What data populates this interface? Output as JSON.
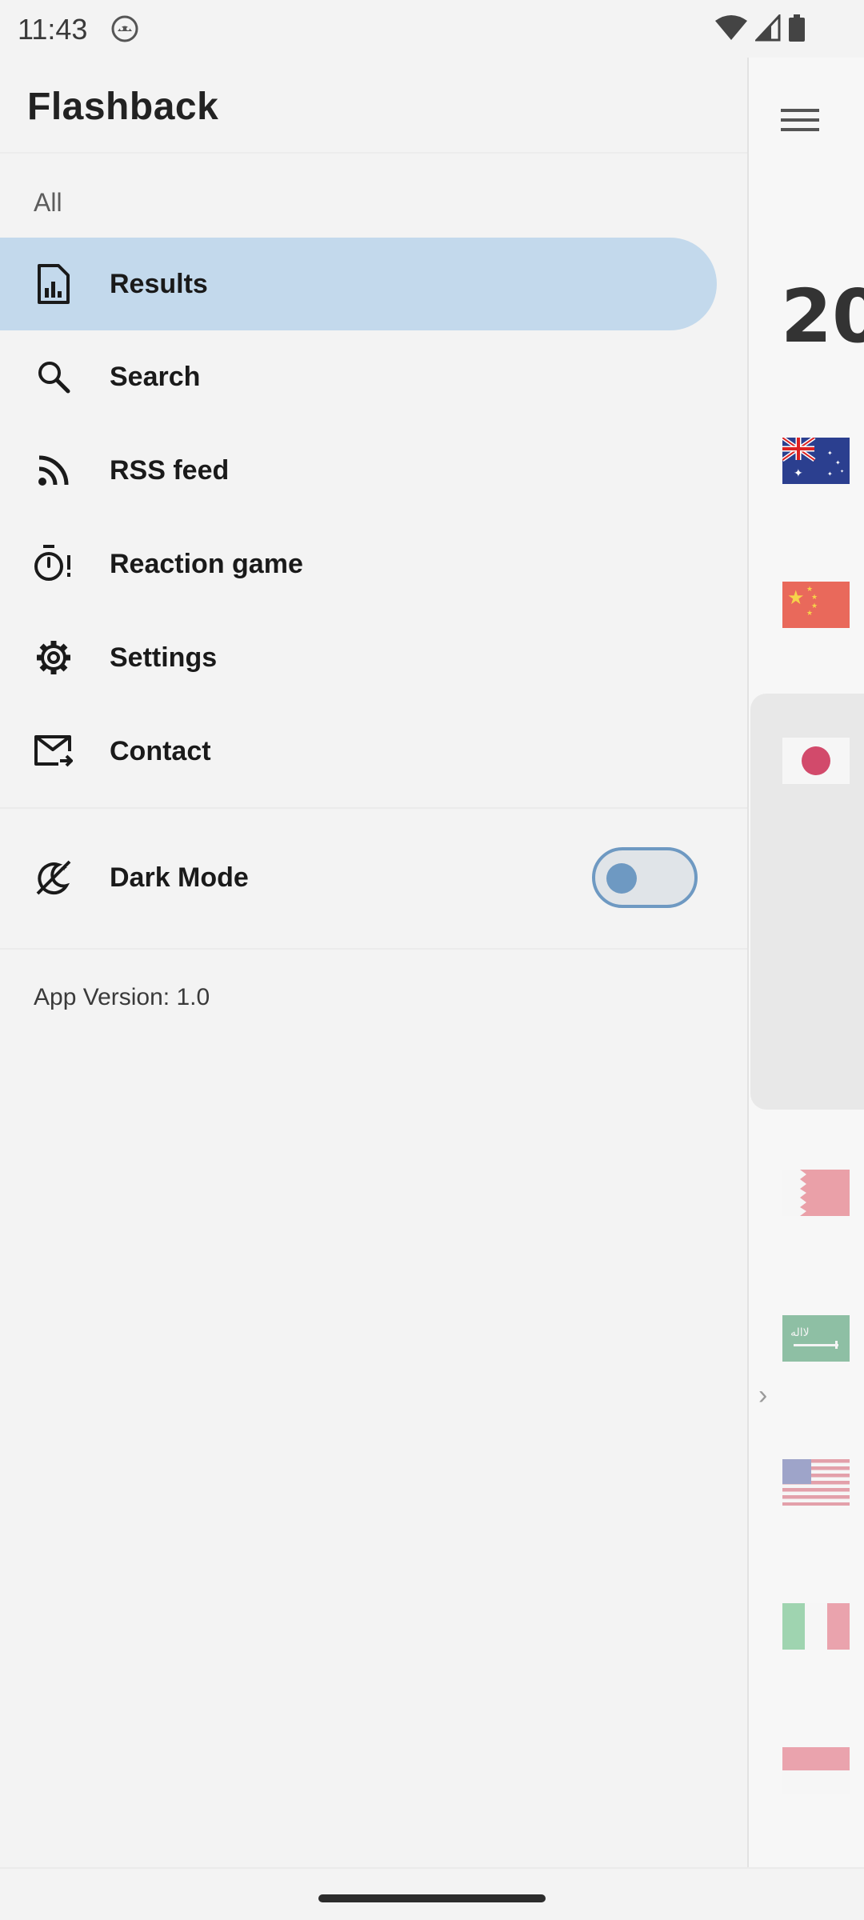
{
  "status_bar": {
    "time": "11:43",
    "notification_icon": "android-robot-icon",
    "icons": [
      "wifi-icon",
      "signal-icon",
      "battery-icon"
    ]
  },
  "drawer": {
    "title": "Flashback",
    "section_label": "All",
    "items": [
      {
        "label": "Results",
        "icon": "results-icon",
        "active": true
      },
      {
        "label": "Search",
        "icon": "search-icon",
        "active": false
      },
      {
        "label": "RSS feed",
        "icon": "rss-icon",
        "active": false
      },
      {
        "label": "Reaction game",
        "icon": "timer-icon",
        "active": false
      },
      {
        "label": "Settings",
        "icon": "gear-icon",
        "active": false
      },
      {
        "label": "Contact",
        "icon": "mail-icon",
        "active": false
      }
    ],
    "dark_mode": {
      "label": "Dark Mode",
      "icon": "dark-mode-icon",
      "enabled": false
    },
    "version": "App Version: 1.0"
  },
  "background_app": {
    "menu_icon": "hamburger-icon",
    "year_partial": "20",
    "flags": [
      "australia-flag",
      "china-flag",
      "japan-flag",
      "bahrain-flag",
      "saudi-arabia-flag",
      "usa-flag",
      "italy-flag",
      "poland-flag"
    ]
  },
  "colors": {
    "background": "#f3f3f3",
    "active_item": "#c3d9ec",
    "toggle_accent": "#6e99c2"
  }
}
